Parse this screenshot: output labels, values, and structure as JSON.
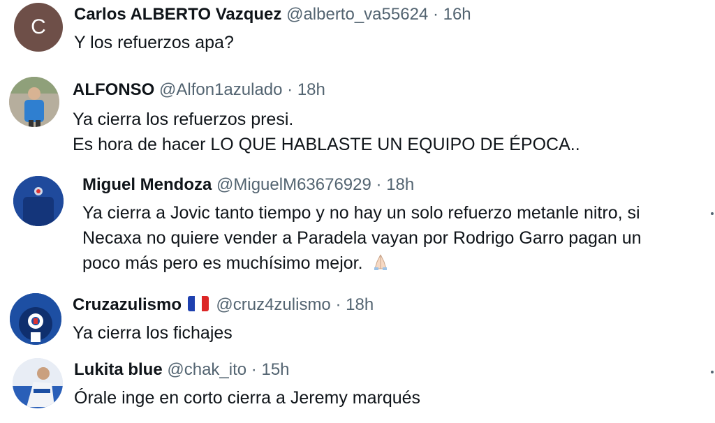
{
  "replies": [
    {
      "name": "Carlos ALBERTO Vazquez",
      "handle": "@alberto_va55624",
      "time": "16h",
      "avatar_letter": "C",
      "lines": [
        "Y los refuerzos apa?"
      ]
    },
    {
      "name": "ALFONSO",
      "handle": "@Alfon1azulado",
      "time": "18h",
      "lines": [
        "Ya cierra los refuerzos presi.",
        "Es hora de hacer LO QUE HABLASTE UN EQUIPO DE ÉPOCA.."
      ]
    },
    {
      "name": "Miguel Mendoza",
      "handle": "@MiguelM63676929",
      "time": "18h",
      "lines": [
        "Ya cierra a Jovic tanto tiempo y no hay un solo refuerzo metanle nitro, si",
        "Necaxa no quiere vender a Paradela vayan por Rodrigo Garro pagan un",
        "poco más pero es muchísimo mejor."
      ],
      "emoji": "folded-hands-icon"
    },
    {
      "name": "Cruzazulismo",
      "handle": "@cruz4zulismo",
      "time": "18h",
      "flag": "france-flag-icon",
      "lines": [
        "Ya cierra los fichajes"
      ]
    },
    {
      "name": "Lukita blue",
      "handle": "@chak_ito",
      "time": "15h",
      "lines": [
        "Órale inge en corto cierra a Jeremy marqués"
      ]
    }
  ],
  "separator": "·",
  "colors": {
    "name": "#0f1419",
    "handle": "#536471",
    "avatar_c": "#6e4f48",
    "cruz_blue": "#1d4fa3"
  }
}
